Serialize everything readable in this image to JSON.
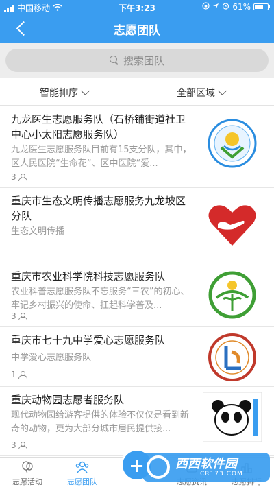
{
  "status_bar": {
    "carrier": "中国移动",
    "time": "下午3:23",
    "battery": "61%"
  },
  "nav": {
    "title": "志愿团队"
  },
  "search": {
    "placeholder": "搜索团队"
  },
  "filters": {
    "sort": "智能排序",
    "region": "全部区域"
  },
  "teams": [
    {
      "title": "九龙医生志愿服务队（石桥铺街道社卫中心小太阳志愿服务队）",
      "desc": "九龙医生志愿服务队目前有15支分队，其中，区人民医院“生命花”、区中医院“爱...",
      "count": "3"
    },
    {
      "title": "重庆市生态文明传播志愿服务九龙坡区分队",
      "desc": "生态文明传播",
      "count": ""
    },
    {
      "title": "重庆市农业科学院科技志愿服务队",
      "desc": "农业科普志愿服务队不忘服务“三农”的初心、牢记乡村振兴的使命、扛起科学普及...",
      "count": "3"
    },
    {
      "title": "重庆市七十九中学爱心志愿服务队",
      "desc": "中学爱心志愿服务队",
      "count": "1"
    },
    {
      "title": "重庆动物园志愿者服务队",
      "desc": "现代动物园给游客提供的体验不仅仅是看到新奇的动物，更为大部分城市居民提供接...",
      "count": "3"
    }
  ],
  "tabs": [
    {
      "label": "志愿活动"
    },
    {
      "label": "志愿团队"
    },
    {
      "label": "志愿资讯"
    },
    {
      "label": "志愿排行"
    }
  ],
  "watermark": {
    "text": "西西软件园",
    "url": "CR173.COM"
  },
  "colors": {
    "primary": "#3a9df0",
    "heart_red": "#d42a2a",
    "green": "#3f9f35"
  }
}
